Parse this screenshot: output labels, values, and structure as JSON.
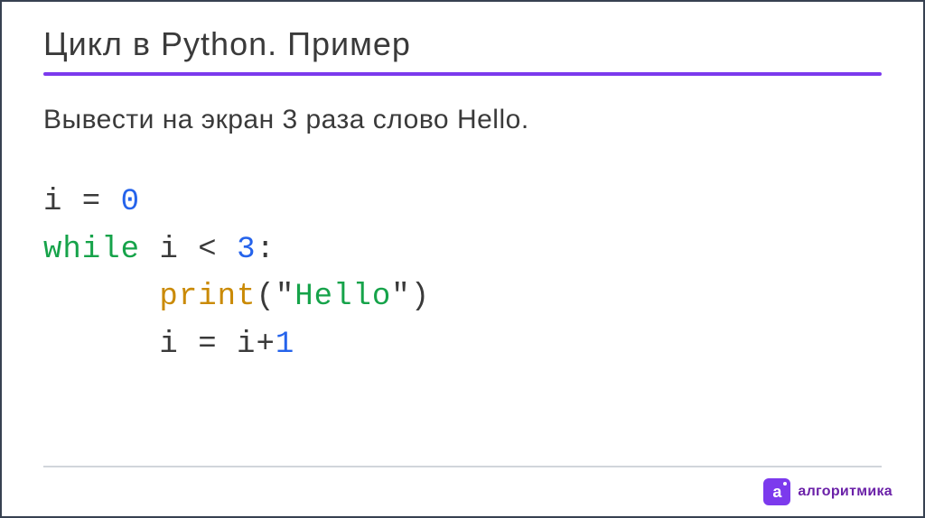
{
  "title": "Цикл в Python. Пример",
  "task": "Вывести на экран 3 раза слово Hello.",
  "code": {
    "line1_var": "i",
    "line1_eq": " = ",
    "line1_val": "0",
    "line2_kw": "while",
    "line2_sp": " ",
    "line2_var": "i",
    "line2_op": " < ",
    "line2_val": "3",
    "line2_colon": ":",
    "line3_indent": "      ",
    "line3_func": "print",
    "line3_open": "(",
    "line3_q1": "\"",
    "line3_str": "Hello",
    "line3_q2": "\"",
    "line3_close": ")",
    "line4_indent": "      ",
    "line4_var": "i",
    "line4_eq": " = ",
    "line4_var2": "i",
    "line4_plus": "+",
    "line4_val": "1"
  },
  "logo": {
    "letter": "a",
    "text": "алгоритмика"
  }
}
